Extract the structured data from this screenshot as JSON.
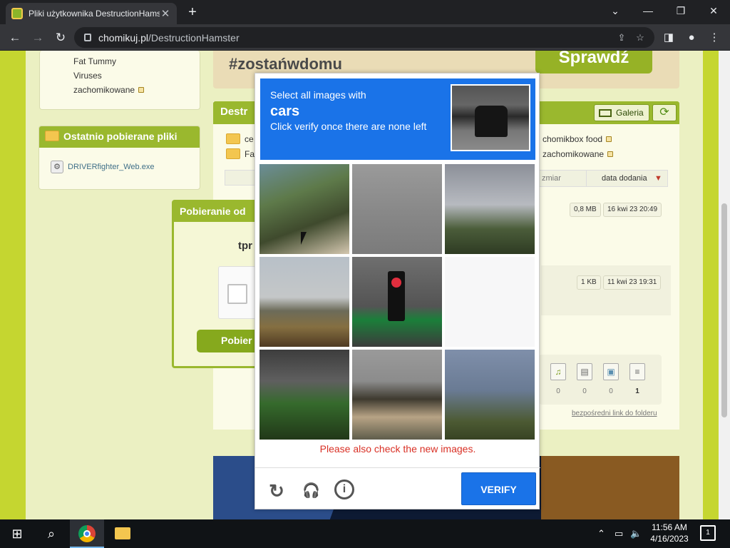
{
  "browser": {
    "tab_title": "Pliki użytkownika DestructionHamster",
    "tab_close": "✕",
    "new_tab": "+",
    "url_domain": "chomikuj.pl",
    "url_path": "/DestructionHamster",
    "win_min": "—",
    "win_restore": "❐",
    "win_close": "✕",
    "tab_list": "⌄"
  },
  "sidebar": {
    "folders": [
      "Fat Tummy",
      "Viruses",
      "zachomikowane"
    ],
    "recent_title": "Ostatnio pobierane pliki",
    "recent_file": "DRIVERfighter_Web.exe"
  },
  "banner": {
    "hashtag": "#zostańwdomu",
    "button": "Sprawdź"
  },
  "main": {
    "title": "Destr",
    "gallery": "Galeria",
    "folder_rows_left": [
      "ce",
      "Fa"
    ],
    "folder_rows_right": [
      "chomikbox food",
      "zachomikowane"
    ],
    "sort_size": "zmiar",
    "sort_date": "data dodania",
    "sort_arrow": "▼",
    "files": [
      {
        "size": "0,8 MB",
        "date": "16 kwi 23 20:49"
      },
      {
        "size": "1 KB",
        "date": "11 kwi 23 19:31"
      }
    ],
    "type_counts": [
      "0",
      "0",
      "0",
      "1"
    ],
    "direct_link": "bezpośredni link do folderu"
  },
  "download": {
    "title": "Pobieranie od",
    "file_prefix": "tpr",
    "button": "Pobier"
  },
  "captcha": {
    "line1": "Select all images with",
    "target": "cars",
    "line2": "Click verify once there are none left",
    "message": "Please also check the new images.",
    "verify": "VERIFY",
    "reload_icon": "↻",
    "audio_icon": "🎧",
    "info_icon": "i"
  },
  "taskbar": {
    "start_icon": "⊞",
    "search_icon": "⌕",
    "time": "11:56 AM",
    "date": "4/16/2023",
    "notifications": "1"
  }
}
